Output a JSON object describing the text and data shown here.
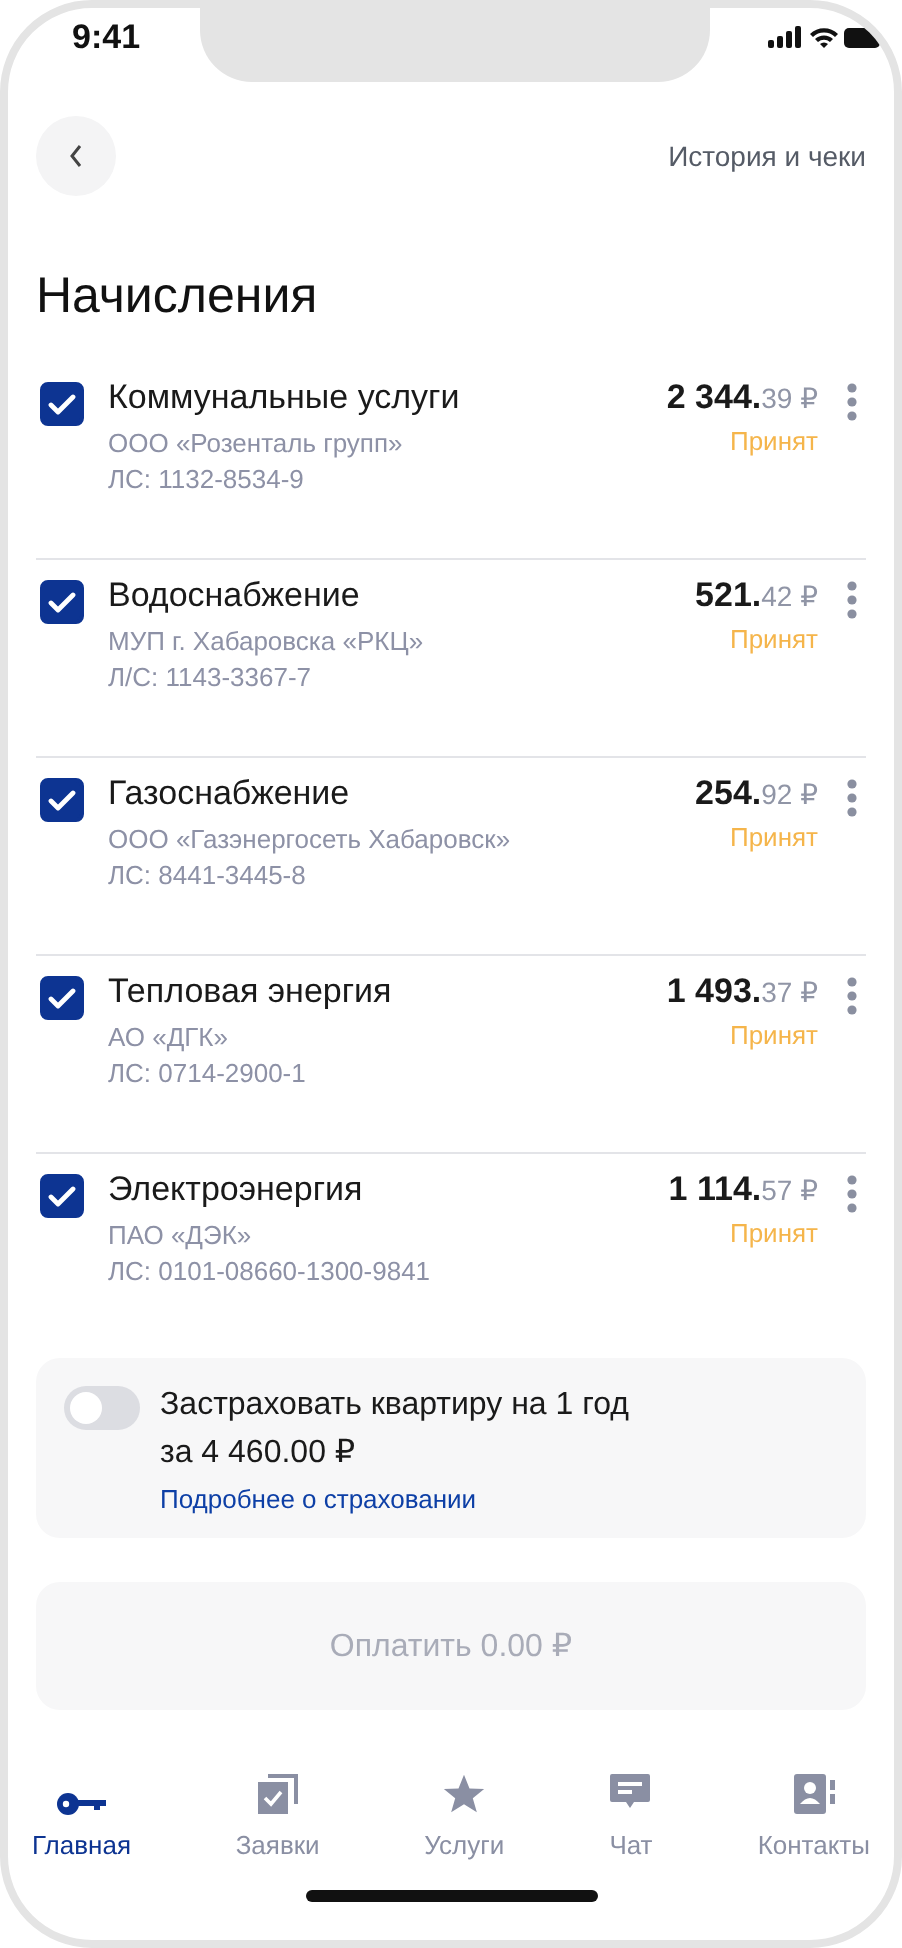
{
  "status_bar": {
    "time": "9:41"
  },
  "header": {
    "link": "История и чеки"
  },
  "title": "Начисления",
  "charges": [
    {
      "name": "Коммунальные услуги",
      "provider": "ООО «Розенталь групп»",
      "account": "ЛС: 1132-8534-9",
      "amount_whole": "2 344.",
      "amount_fraction": "39 ₽",
      "status": "Принят",
      "checked": true
    },
    {
      "name": "Водоснабжение",
      "provider": "МУП г. Хабаровска «РКЦ»",
      "account": "Л/С: 1143-3367-7",
      "amount_whole": "521.",
      "amount_fraction": "42 ₽",
      "status": "Принят",
      "checked": true
    },
    {
      "name": "Газоснабжение",
      "provider": "ООО «Газэнергосеть Хабаровск»",
      "account": "ЛС: 8441-3445-8",
      "amount_whole": "254.",
      "amount_fraction": "92 ₽",
      "status": "Принят",
      "checked": true
    },
    {
      "name": "Тепловая энергия",
      "provider": "АО «ДГК»",
      "account": "ЛС: 0714-2900-1",
      "amount_whole": "1 493.",
      "amount_fraction": "37 ₽",
      "status": "Принят",
      "checked": true
    },
    {
      "name": "Электроэнергия",
      "provider": "ПАО «ДЭК»",
      "account": "ЛС: 0101-08660-1300-9841",
      "amount_whole": "1 114.",
      "amount_fraction": "57 ₽",
      "status": "Принят",
      "checked": true
    }
  ],
  "insurance": {
    "on": false,
    "title": "Застраховать квартиру на 1 год",
    "price": "за 4 460.00 ₽",
    "link": "Подробнее о страховании"
  },
  "pay_button": {
    "label": "Оплатить 0.00 ₽",
    "disabled": true
  },
  "tabs": [
    {
      "label": "Главная",
      "selected": true
    },
    {
      "label": "Заявки",
      "selected": false
    },
    {
      "label": "Услуги",
      "selected": false
    },
    {
      "label": "Чат",
      "selected": false
    },
    {
      "label": "Контакты",
      "selected": false
    }
  ]
}
